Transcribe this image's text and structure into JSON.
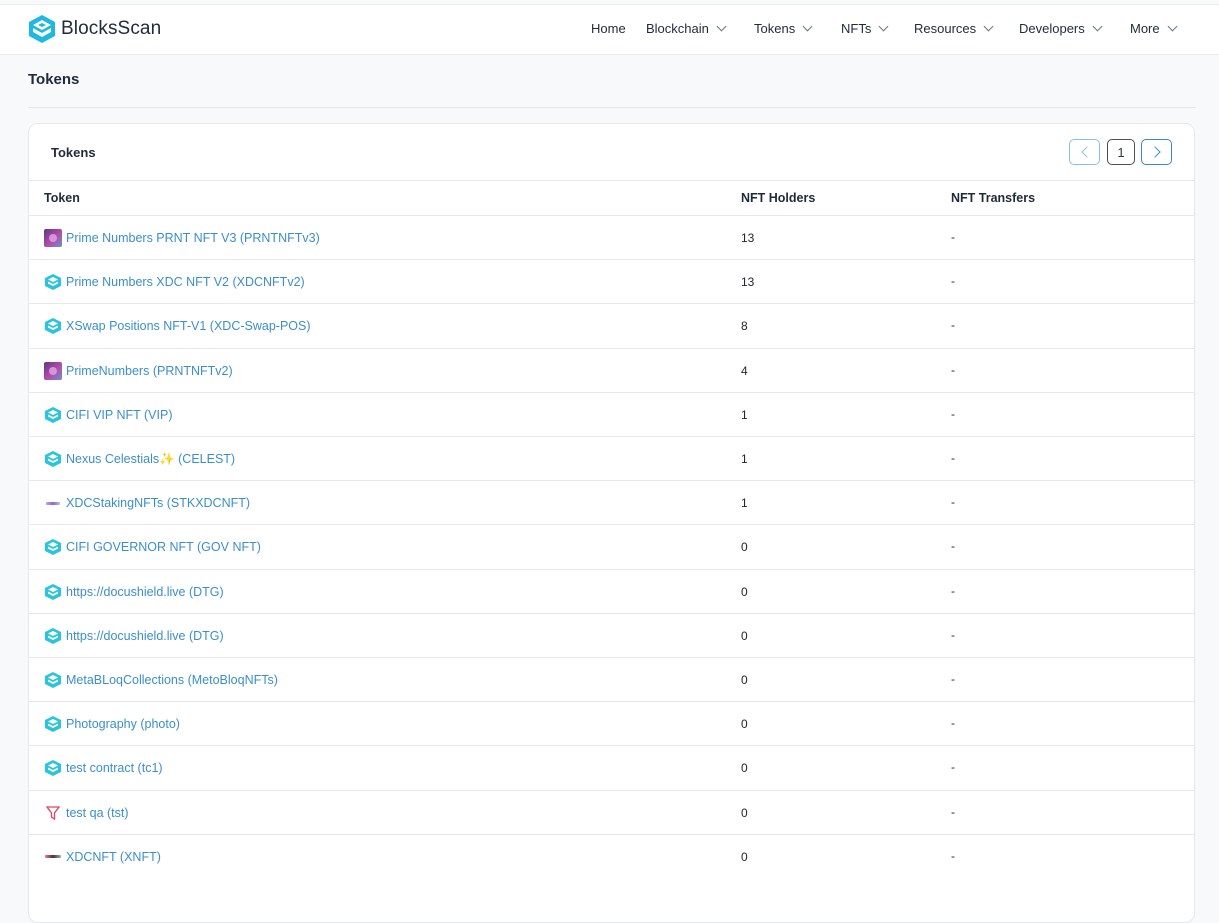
{
  "brand": {
    "name": "BlocksScan",
    "accent": "#1fc2e8"
  },
  "nav": [
    {
      "label": "Home",
      "dropdown": false
    },
    {
      "label": "Blockchain",
      "dropdown": true
    },
    {
      "label": "Tokens",
      "dropdown": true
    },
    {
      "label": "NFTs",
      "dropdown": true
    },
    {
      "label": "Resources",
      "dropdown": true
    },
    {
      "label": "Developers",
      "dropdown": true
    },
    {
      "label": "More",
      "dropdown": true
    }
  ],
  "page": {
    "title": "Tokens"
  },
  "card": {
    "title": "Tokens",
    "pager": {
      "current": "1",
      "prev_icon": "chevron-left-icon",
      "next_icon": "chevron-right-icon"
    },
    "columns": [
      "Token",
      "NFT Holders",
      "NFT Transfers"
    ],
    "rows": [
      {
        "name": "Prime Numbers PRNT NFT V3 (PRNTNFTv3)",
        "holders": "13",
        "transfers": "-",
        "icon": "prime-numbers-image"
      },
      {
        "name": "Prime Numbers XDC NFT V2 (XDCNFTv2)",
        "holders": "13",
        "transfers": "-",
        "icon": "blocksscan-token-icon"
      },
      {
        "name": "XSwap Positions NFT-V1 (XDC-Swap-POS)",
        "holders": "8",
        "transfers": "-",
        "icon": "blocksscan-token-icon"
      },
      {
        "name": "PrimeNumbers (PRNTNFTv2)",
        "holders": "4",
        "transfers": "-",
        "icon": "prime-numbers-image"
      },
      {
        "name": "CIFI VIP NFT (VIP)",
        "holders": "1",
        "transfers": "-",
        "icon": "blocksscan-token-icon"
      },
      {
        "name": "Nexus Celestials✨ (CELEST)",
        "holders": "1",
        "transfers": "-",
        "icon": "blocksscan-token-icon"
      },
      {
        "name": "XDCStakingNFTs (STKXDCNFT)",
        "holders": "1",
        "transfers": "-",
        "icon": "staking-logo-image"
      },
      {
        "name": "CIFI GOVERNOR NFT (GOV NFT)",
        "holders": "0",
        "transfers": "-",
        "icon": "blocksscan-token-icon"
      },
      {
        "name": "https://docushield.live (DTG)",
        "holders": "0",
        "transfers": "-",
        "icon": "blocksscan-token-icon"
      },
      {
        "name": "https://docushield.live (DTG)",
        "holders": "0",
        "transfers": "-",
        "icon": "blocksscan-token-icon"
      },
      {
        "name": "MetaBLoqCollections (MetoBloqNFTs)",
        "holders": "0",
        "transfers": "-",
        "icon": "blocksscan-token-icon"
      },
      {
        "name": "Photography (photo)",
        "holders": "0",
        "transfers": "-",
        "icon": "blocksscan-token-icon"
      },
      {
        "name": "test contract (tc1)",
        "holders": "0",
        "transfers": "-",
        "icon": "blocksscan-token-icon"
      },
      {
        "name": "test qa (tst)",
        "holders": "0",
        "transfers": "-",
        "icon": "funnel-logo-image"
      },
      {
        "name": "XDCNFT (XNFT)",
        "holders": "0",
        "transfers": "-",
        "icon": "xdc-logo-image"
      }
    ]
  }
}
